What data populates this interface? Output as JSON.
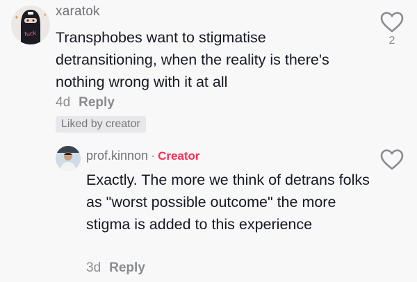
{
  "comment": {
    "username": "xaratok",
    "avatar_caption": "fuck",
    "text": "Transphobes want to stigmatise detransitioning, when the reality is there's nothing wrong with it at all",
    "age": "4d",
    "reply_label": "Reply",
    "liked_badge": "Liked by creator",
    "like_count": "2",
    "like_icon": "heart-outline-icon"
  },
  "reply": {
    "username": "prof.kinnon",
    "separator": "·",
    "creator_label": "Creator",
    "text": "Exactly. The more we think of detrans folks as \"worst possible outcome\" the more stigma is added to this experience",
    "age": "3d",
    "reply_label": "Reply",
    "like_icon": "heart-outline-icon"
  },
  "colors": {
    "background": "#f8f8f8",
    "text": "#161823",
    "secondary_text": "#8a8b91",
    "creator_accent": "#fe2c55"
  }
}
